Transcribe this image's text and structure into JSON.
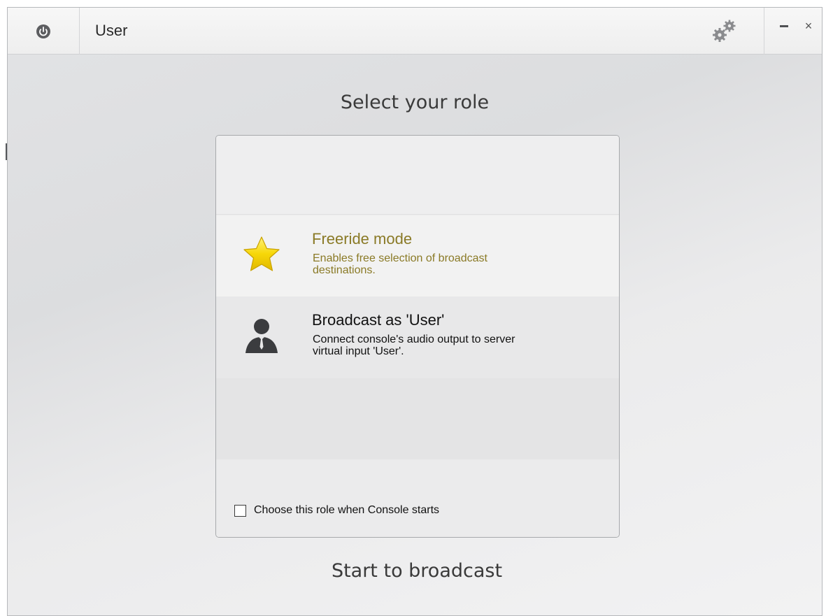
{
  "window": {
    "title": "User",
    "power_icon": "power-icon",
    "settings_icon": "gears-icon",
    "minimize_label": "–",
    "close_label": "×"
  },
  "main": {
    "heading": "Select your role",
    "roles": [
      {
        "title": "Freeride mode",
        "description": "Enables free selection of broadcast destinations.",
        "icon": "star-icon",
        "selected": true
      },
      {
        "title": "Broadcast as 'User'",
        "description": "Connect console's audio output to server virtual input 'User'.",
        "icon": "user-icon",
        "selected": false
      }
    ],
    "startup_checkbox": {
      "label": "Choose this role when Console starts",
      "checked": false
    },
    "start_button": "Start to broadcast"
  },
  "colors": {
    "selected_role_text": "#8a7a26",
    "role_text": "#111111",
    "star_fill": "#f7d708"
  }
}
